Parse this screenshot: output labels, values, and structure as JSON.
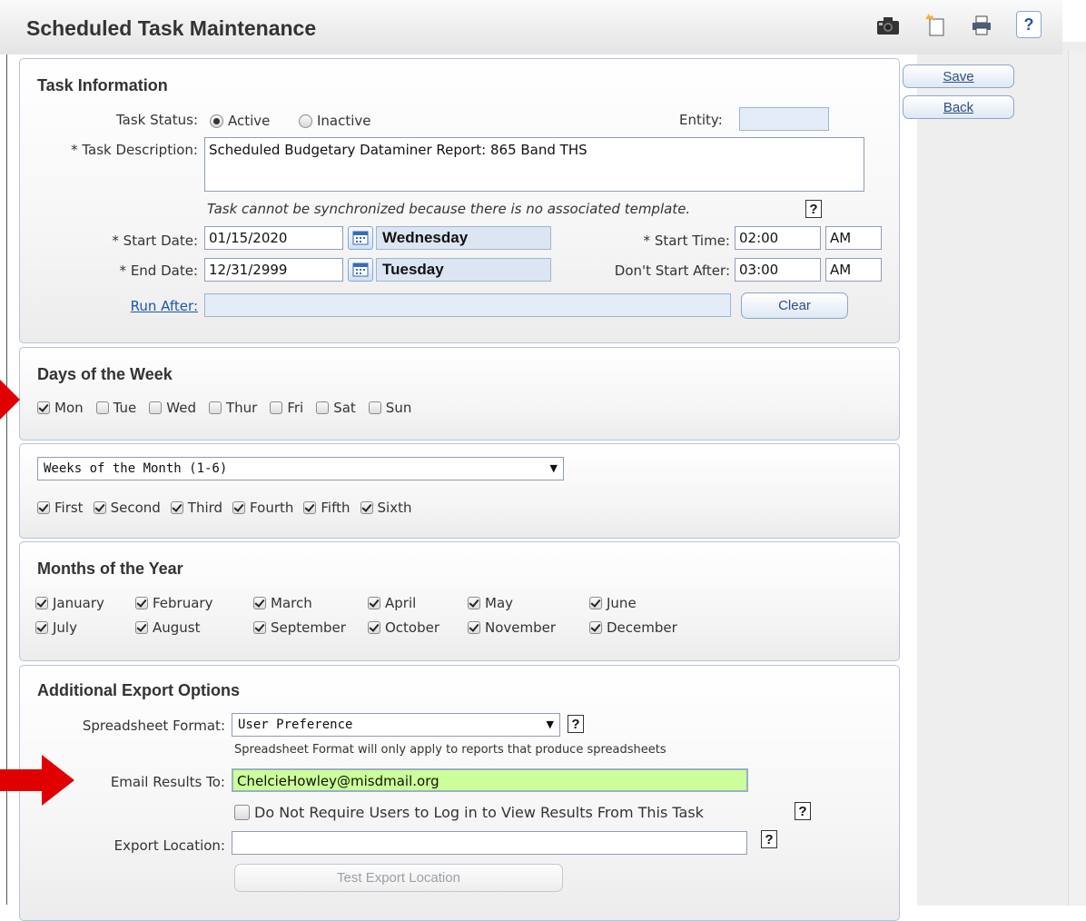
{
  "header": {
    "title": "Scheduled Task Maintenance",
    "help_label": "?"
  },
  "actions": {
    "save_label": "Save",
    "back_label": "Back"
  },
  "task_info": {
    "title": "Task Information",
    "task_status_label": "Task Status:",
    "status_options": [
      "Active",
      "Inactive"
    ],
    "status_selected": "Active",
    "entity_label": "Entity:",
    "entity_value": "",
    "description_label": "* Task Description:",
    "description_value": "Scheduled Budgetary Dataminer Report: 865 Band THS",
    "sync_note": "Task cannot be synchronized because there is no associated template.",
    "help_label": "?",
    "start_date_label": "* Start Date:",
    "start_date_value": "01/15/2020",
    "start_day": "Wednesday",
    "end_date_label": "* End Date:",
    "end_date_value": "12/31/2999",
    "end_day": "Tuesday",
    "start_time_label": "* Start Time:",
    "start_time_value": "02:00",
    "start_ampm": "AM",
    "dont_start_label": "Don't Start After:",
    "dont_start_value": "03:00",
    "dont_start_ampm": "AM",
    "run_after_label": "Run After:",
    "run_after_value": "",
    "clear_label": "Clear"
  },
  "days_of_week": {
    "title": "Days of the Week",
    "days": [
      {
        "label": "Mon",
        "checked": true
      },
      {
        "label": "Tue",
        "checked": false
      },
      {
        "label": "Wed",
        "checked": false
      },
      {
        "label": "Thur",
        "checked": false
      },
      {
        "label": "Fri",
        "checked": false
      },
      {
        "label": "Sat",
        "checked": false
      },
      {
        "label": "Sun",
        "checked": false
      }
    ]
  },
  "weeks_of_month": {
    "select_value": "Weeks of the Month (1-6)",
    "weeks": [
      {
        "label": "First",
        "checked": true
      },
      {
        "label": "Second",
        "checked": true
      },
      {
        "label": "Third",
        "checked": true
      },
      {
        "label": "Fourth",
        "checked": true
      },
      {
        "label": "Fifth",
        "checked": true
      },
      {
        "label": "Sixth",
        "checked": true
      }
    ]
  },
  "months": {
    "title": "Months of the Year",
    "items": [
      {
        "label": "January",
        "checked": true
      },
      {
        "label": "February",
        "checked": true
      },
      {
        "label": "March",
        "checked": true
      },
      {
        "label": "April",
        "checked": true
      },
      {
        "label": "May",
        "checked": true
      },
      {
        "label": "June",
        "checked": true
      },
      {
        "label": "July",
        "checked": true
      },
      {
        "label": "August",
        "checked": true
      },
      {
        "label": "September",
        "checked": true
      },
      {
        "label": "October",
        "checked": true
      },
      {
        "label": "November",
        "checked": true
      },
      {
        "label": "December",
        "checked": true
      }
    ]
  },
  "export": {
    "title": "Additional Export Options",
    "format_label": "Spreadsheet Format:",
    "format_value": "User Preference",
    "format_note": "Spreadsheet Format will only apply to reports that produce spreadsheets",
    "email_label": "Email Results To:",
    "email_value": "ChelcieHowley@misdmail.org",
    "no_login_label": "Do Not Require Users to Log in to View Results From This Task",
    "no_login_checked": false,
    "location_label": "Export Location:",
    "location_value": "",
    "test_label": "Test Export Location",
    "help_label": "?"
  },
  "colors": {
    "annotation_arrow": "#e00000",
    "email_highlight": "#ccff99",
    "link": "#1a56b0"
  }
}
